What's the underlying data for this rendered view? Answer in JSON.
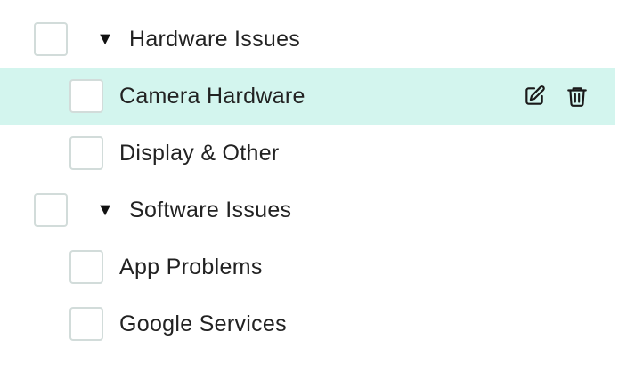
{
  "tree": {
    "items": [
      {
        "label": "Hardware Issues",
        "type": "group",
        "expanded": true,
        "expand_icon": "triangle-down-icon"
      },
      {
        "label": "Camera Hardware",
        "type": "category",
        "highlighted": true
      },
      {
        "label": "Display & Other",
        "type": "category"
      },
      {
        "label": "Software Issues",
        "type": "group",
        "expanded": true,
        "expand_icon": "triangle-down-icon"
      },
      {
        "label": "App Problems",
        "type": "category"
      },
      {
        "label": "Google Services",
        "type": "category"
      }
    ],
    "caret_glyph": "▼",
    "row_actions": {
      "edit_icon": "edit-icon",
      "delete_icon": "trash-icon"
    }
  },
  "colors": {
    "highlight_background": "#d3f5ee",
    "checkbox_border": "#d2dcda",
    "text": "#222222"
  }
}
